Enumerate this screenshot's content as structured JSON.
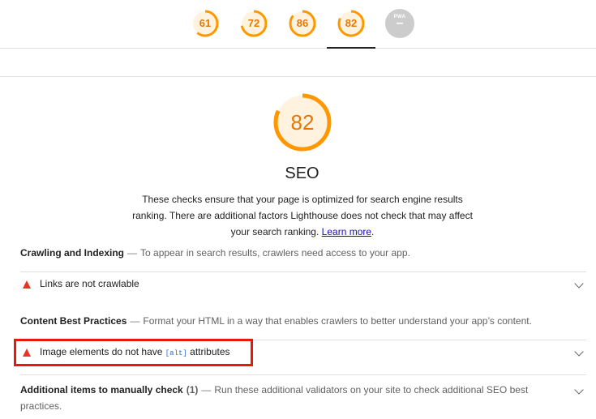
{
  "score_tabs": [
    {
      "value": "61",
      "color": "#e67700"
    },
    {
      "value": "72",
      "color": "#e67700"
    },
    {
      "value": "86",
      "color": "#e67700"
    },
    {
      "value": "82",
      "color": "#e67700",
      "active": true
    },
    {
      "value": "–",
      "badge": "PWA",
      "color": "#cccccc"
    }
  ],
  "category": {
    "score": "82",
    "title": "SEO",
    "description": "These checks ensure that your page is optimized for search engine results ranking. There are additional factors Lighthouse does not check that may affect your search ranking.",
    "learn_more": "Learn more",
    "period": "."
  },
  "groups": [
    {
      "title": "Crawling and Indexing",
      "description": "To appear in search results, crawlers need access to your app.",
      "audit": "Links are not crawlable"
    },
    {
      "title": "Content Best Practices",
      "description": "Format your HTML in a way that enables crawlers to better understand your app’s content.",
      "audit_prefix": "Image elements do not have",
      "audit_code": "[alt]",
      "audit_suffix": "attributes"
    },
    {
      "title": "Additional items to manually check",
      "count": "(1)",
      "description": "Run these additional validators on your site to check additional SEO best practices."
    }
  ],
  "colors": {
    "orange": "#e67700",
    "fail": "#eb3323",
    "highlight": "#e8180c"
  }
}
